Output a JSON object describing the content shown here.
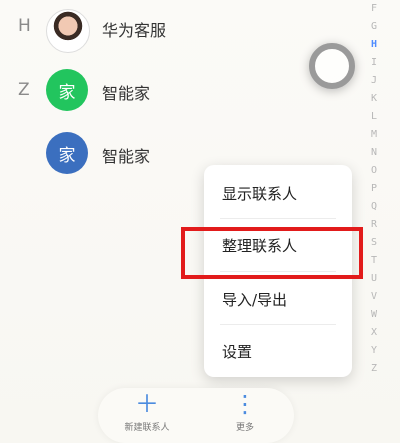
{
  "contacts": [
    {
      "section": "H",
      "name": "华为客服",
      "avatar": {
        "kind": "photo",
        "icon": "support-agent-avatar"
      }
    },
    {
      "section": "Z",
      "name": "智能家",
      "avatar": {
        "kind": "text",
        "text": "家",
        "color": "#22c55e"
      }
    },
    {
      "section": "",
      "name": "智能家",
      "avatar": {
        "kind": "text",
        "text": "家",
        "color": "#3b6fbf"
      }
    }
  ],
  "index_letters": [
    "F",
    "G",
    "H",
    "I",
    "J",
    "K",
    "L",
    "M",
    "N",
    "O",
    "P",
    "Q",
    "R",
    "S",
    "T",
    "U",
    "V",
    "W",
    "X",
    "Y",
    "Z"
  ],
  "index_active": "H",
  "menu": {
    "items": [
      "显示联系人",
      "整理联系人",
      "导入/导出",
      "设置"
    ],
    "highlighted_index": 1
  },
  "bottom_bar": {
    "new_contact": {
      "label": "新建联系人",
      "icon": "plus-icon"
    },
    "more": {
      "label": "更多",
      "icon": "more-vertical-icon"
    }
  },
  "colors": {
    "highlight": "#e21b1b",
    "accent": "#4b8bdf",
    "active_index": "#4f8cff"
  }
}
